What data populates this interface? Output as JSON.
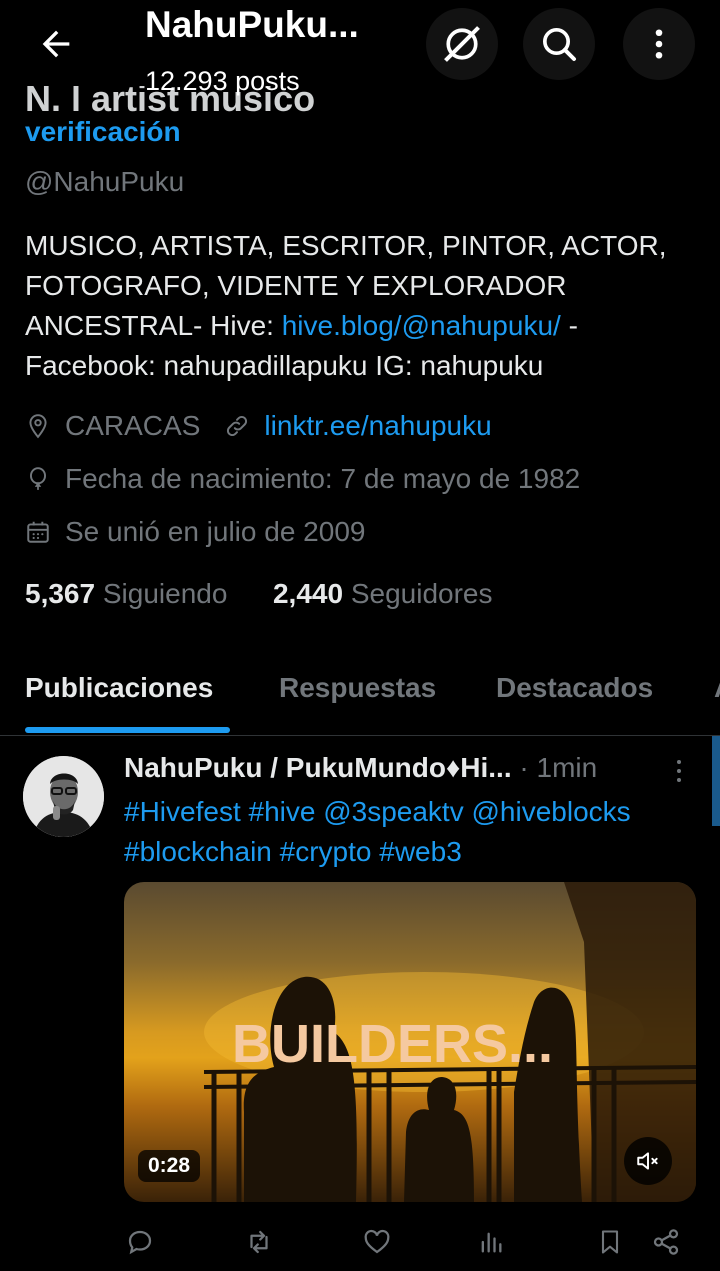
{
  "header": {
    "title": "NahuPuku...",
    "posts_count": "12.293 posts",
    "partial_name": "N. l artist musico"
  },
  "profile": {
    "verification_text": "verificación",
    "handle": "@NahuPuku",
    "bio_part1": "MUSICO, ARTISTA, ESCRITOR, PINTOR, ACTOR, FOTOGRAFO, VIDENTE Y EXPLORADOR ANCESTRAL- Hive: ",
    "bio_link": "hive.blog/@nahupuku/",
    "bio_part2": " - Facebook: nahupadillapuku IG: nahupuku",
    "location": "CARACAS",
    "website": "linktr.ee/nahupuku",
    "birth": "Fecha de nacimiento: 7 de mayo de 1982",
    "joined": "Se unió en julio de 2009",
    "following_count": "5,367",
    "following_label": "Siguiendo",
    "followers_count": "2,440",
    "followers_label": "Seguidores"
  },
  "tabs": [
    "Publicaciones",
    "Respuestas",
    "Destacados",
    "A"
  ],
  "post": {
    "author": "NahuPuku / PukuMundo♦Hi...",
    "time": "· 1min",
    "text": "#Hivefest #hive @3speaktv @hiveblocks #blockchain #crypto #web3",
    "media_title": "BUILDERS...",
    "duration": "0:28"
  },
  "icons": [
    "back-arrow-icon",
    "grok-icon",
    "search-icon",
    "more-vertical-icon",
    "location-icon",
    "link-icon",
    "balloon-icon",
    "calendar-icon",
    "more-icon",
    "mute-icon",
    "reply-icon",
    "repost-icon",
    "like-icon",
    "views-icon",
    "bookmark-icon",
    "share-icon"
  ],
  "colors": {
    "background": "#000000",
    "accent": "#1d9bf0",
    "text": "#e7e9ea",
    "muted": "#71767b"
  }
}
